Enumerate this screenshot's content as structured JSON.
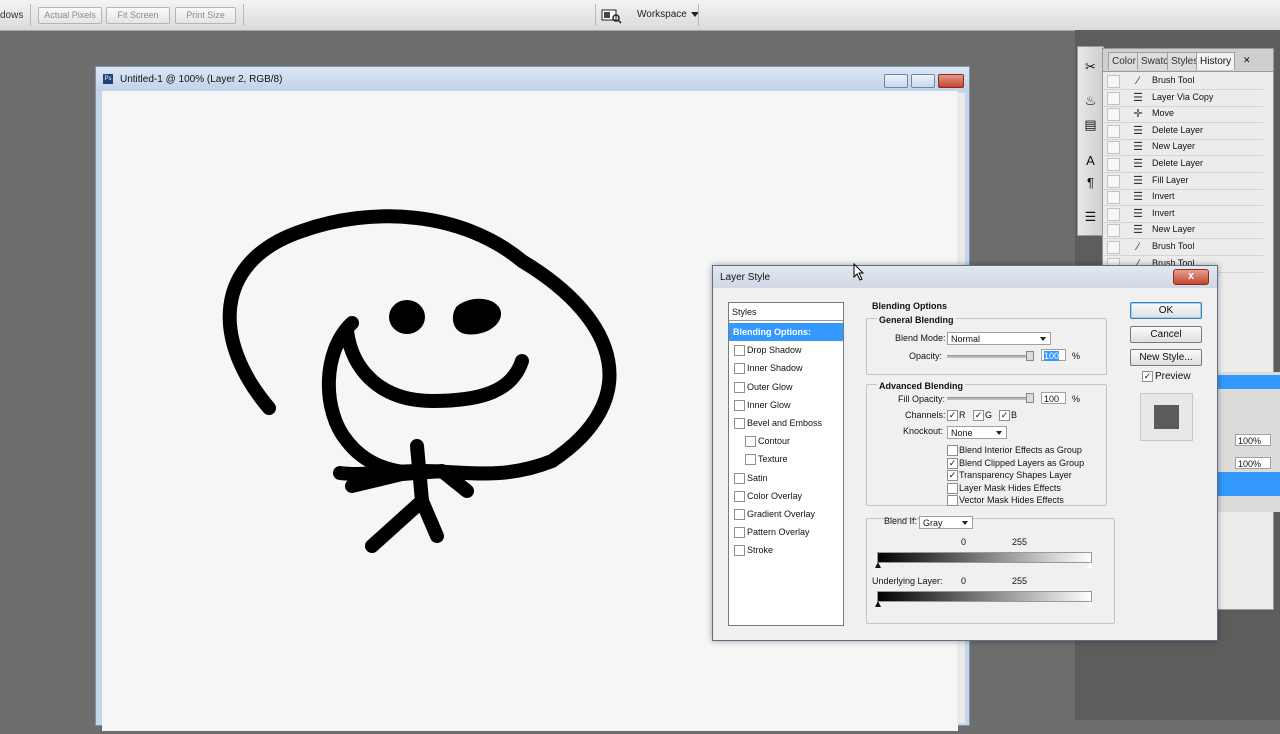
{
  "options_bar": {
    "left_text": "dows",
    "buttons": [
      "Actual Pixels",
      "Fit Screen",
      "Print Size"
    ],
    "workspace_label": "Workspace"
  },
  "document": {
    "title": "Untitled-1 @ 100% (Layer 2, RGB/8)",
    "icon_text": "Ps"
  },
  "panel_tabs": [
    "Color",
    "Swatc",
    "Styles",
    "History"
  ],
  "history_items": [
    {
      "label": "Brush Tool",
      "icon": "brush-icon"
    },
    {
      "label": "Layer Via Copy",
      "icon": "document-icon"
    },
    {
      "label": "Move",
      "icon": "move-icon"
    },
    {
      "label": "Delete Layer",
      "icon": "document-icon"
    },
    {
      "label": "New Layer",
      "icon": "document-icon"
    },
    {
      "label": "Delete Layer",
      "icon": "document-icon"
    },
    {
      "label": "Fill Layer",
      "icon": "document-icon"
    },
    {
      "label": "Invert",
      "icon": "document-icon"
    },
    {
      "label": "Invert",
      "icon": "document-icon"
    },
    {
      "label": "New Layer",
      "icon": "document-icon"
    },
    {
      "label": "Brush Tool",
      "icon": "brush-icon"
    },
    {
      "label": "Brush Tool",
      "icon": "brush-icon"
    }
  ],
  "mini_panel": {
    "val1": "100%",
    "val2": "100%"
  },
  "dialog": {
    "title": "Layer Style",
    "close": "x",
    "styles_header": "Styles",
    "style_items": [
      {
        "label": "Blending Options: Default",
        "selected": true,
        "checkbox": false,
        "indent": false
      },
      {
        "label": "Drop Shadow",
        "checkbox": true,
        "indent": false
      },
      {
        "label": "Inner Shadow",
        "checkbox": true,
        "indent": false
      },
      {
        "label": "Outer Glow",
        "checkbox": true,
        "indent": false
      },
      {
        "label": "Inner Glow",
        "checkbox": true,
        "indent": false
      },
      {
        "label": "Bevel and Emboss",
        "checkbox": true,
        "indent": false
      },
      {
        "label": "Contour",
        "checkbox": true,
        "indent": true
      },
      {
        "label": "Texture",
        "checkbox": true,
        "indent": true
      },
      {
        "label": "Satin",
        "checkbox": true,
        "indent": false
      },
      {
        "label": "Color Overlay",
        "checkbox": true,
        "indent": false
      },
      {
        "label": "Gradient Overlay",
        "checkbox": true,
        "indent": false
      },
      {
        "label": "Pattern Overlay",
        "checkbox": true,
        "indent": false
      },
      {
        "label": "Stroke",
        "checkbox": true,
        "indent": false
      }
    ],
    "blending_options_title": "Blending Options",
    "general": {
      "title": "General Blending",
      "blend_mode_label": "Blend Mode:",
      "blend_mode_value": "Normal",
      "opacity_label": "Opacity:",
      "opacity_value": "100",
      "opacity_unit": "%"
    },
    "advanced": {
      "title": "Advanced Blending",
      "fill_opacity_label": "Fill Opacity:",
      "fill_opacity_value": "100",
      "fill_unit": "%",
      "channels_label": "Channels:",
      "channels": [
        "R",
        "G",
        "B"
      ],
      "knockout_label": "Knockout:",
      "knockout_value": "None",
      "options": [
        {
          "label": "Blend Interior Effects as Group",
          "checked": false
        },
        {
          "label": "Blend Clipped Layers as Group",
          "checked": true
        },
        {
          "label": "Transparency Shapes Layer",
          "checked": true
        },
        {
          "label": "Layer Mask Hides Effects",
          "checked": false
        },
        {
          "label": "Vector Mask Hides Effects",
          "checked": false
        }
      ]
    },
    "blend_if": {
      "label": "Blend If:",
      "value": "Gray",
      "this_layer_min": "0",
      "this_layer_max": "255",
      "underlying_label": "Underlying Layer:",
      "underlying_min": "0",
      "underlying_max": "255"
    },
    "buttons": {
      "ok": "OK",
      "cancel": "Cancel",
      "new_style": "New Style...",
      "preview": "Preview"
    },
    "preview_checked": true
  },
  "colors": {
    "selection": "#3399ff",
    "canvas": "#f6f6f6",
    "stroke": "#000000"
  }
}
